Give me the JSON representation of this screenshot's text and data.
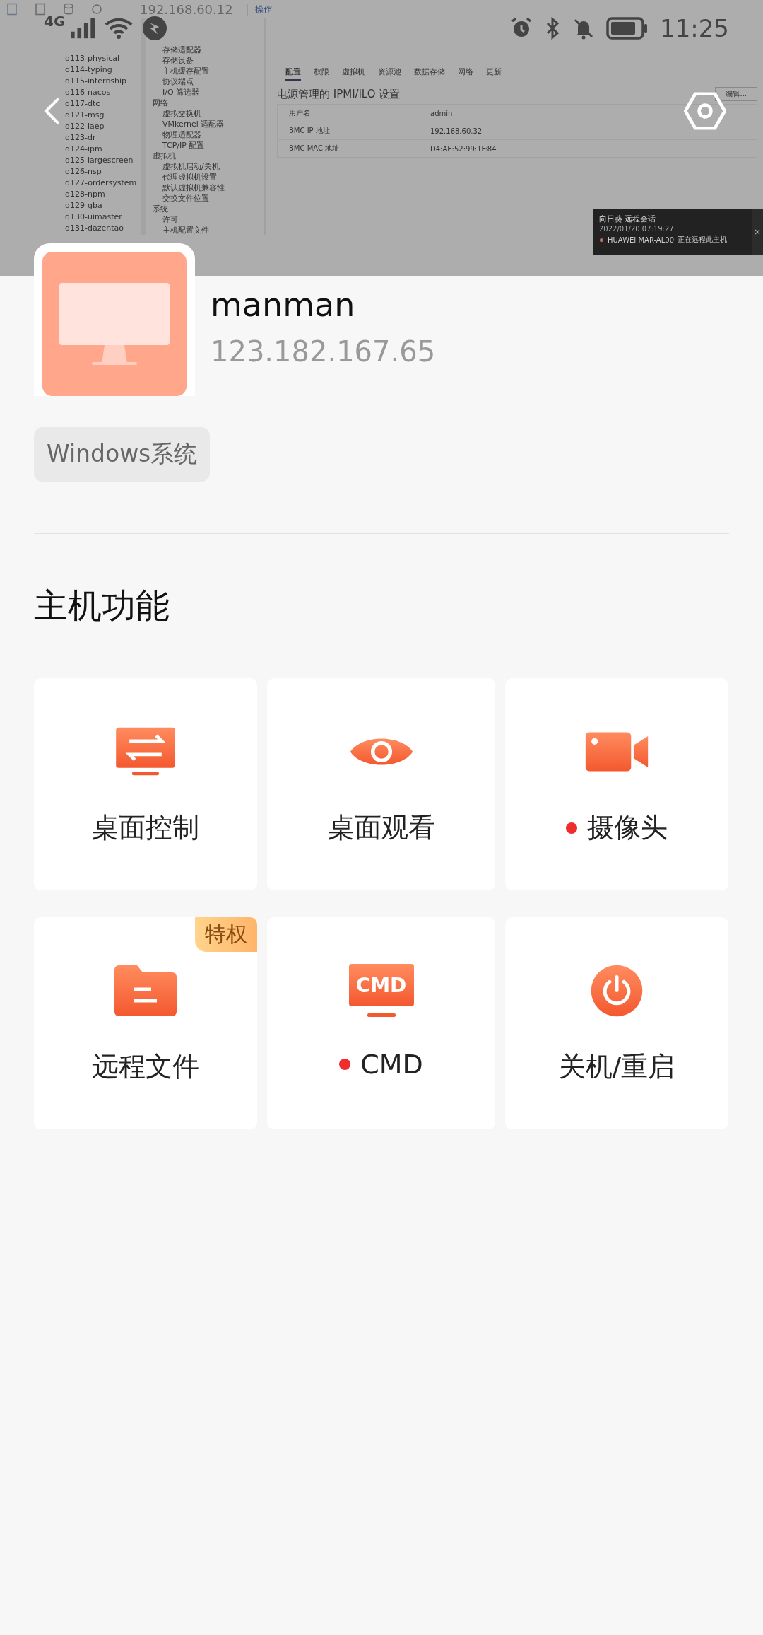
{
  "remote_screen": {
    "address": "192.168.60.12",
    "actions_menu": "操作",
    "vm_list": [
      "d113-physical",
      "d114-typing",
      "d115-internship",
      "d116-nacos",
      "d117-dtc",
      "d121-msg",
      "d122-iaep",
      "d123-dr",
      "d124-ipm",
      "d125-largescreen",
      "d126-nsp",
      "d127-ordersystem",
      "d128-npm",
      "d129-gba",
      "d130-uimaster",
      "d131-dazentao"
    ],
    "tabs": [
      {
        "label": "配置",
        "selected": true
      },
      {
        "label": "权限",
        "selected": false
      },
      {
        "label": "虚拟机",
        "selected": false
      },
      {
        "label": "资源池",
        "selected": false
      },
      {
        "label": "数据存储",
        "selected": false
      },
      {
        "label": "网络",
        "selected": false
      },
      {
        "label": "更新",
        "selected": false
      }
    ],
    "tree": [
      {
        "label": "存储适配器"
      },
      {
        "label": "存储设备"
      },
      {
        "label": "主机缓存配置"
      },
      {
        "label": "协议端点"
      },
      {
        "label": "I/O 筛选器"
      },
      {
        "label": "网络",
        "children": [
          {
            "label": "虚拟交换机"
          },
          {
            "label": "VMkernel 适配器"
          },
          {
            "label": "物理适配器"
          },
          {
            "label": "TCP/IP 配置"
          }
        ]
      },
      {
        "label": "虚拟机",
        "children": [
          {
            "label": "虚拟机启动/关机"
          },
          {
            "label": "代理虚拟机设置"
          },
          {
            "label": "默认虚拟机兼容性"
          },
          {
            "label": "交换文件位置"
          }
        ]
      },
      {
        "label": "系统",
        "children": [
          {
            "label": "许可"
          },
          {
            "label": "主机配置文件"
          }
        ]
      }
    ],
    "heading": "电源管理的 IPMI/iLO 设置",
    "edit_button": "编辑...",
    "rows": [
      {
        "label": "用户名",
        "value": "admin"
      },
      {
        "label": "BMC IP 地址",
        "value": "192.168.60.32"
      },
      {
        "label": "BMC MAC 地址",
        "value": "D4:AE:52:99:1F:84"
      }
    ],
    "notification": {
      "title": "向日葵 远程会话",
      "time": "2022/01/20 07:19:27",
      "device": "HUAWEI MAR-AL00",
      "status": "正在远程此主机",
      "close": "×"
    }
  },
  "status_bar": {
    "network": "4G",
    "time": "11:25"
  },
  "host": {
    "name": "manman",
    "ip": "123.182.167.65",
    "tag": "Windows系统"
  },
  "section_title": "主机功能",
  "functions": [
    {
      "kind": "desktop-control",
      "label": "桌面控制",
      "dot": false
    },
    {
      "kind": "desktop-view",
      "label": "桌面观看",
      "dot": false
    },
    {
      "kind": "camera",
      "label": "摄像头",
      "dot": true
    },
    {
      "kind": "files",
      "label": "远程文件",
      "dot": false,
      "badge": "特权"
    },
    {
      "kind": "cmd",
      "label": "CMD",
      "dot": true,
      "icon_text": "CMD"
    },
    {
      "kind": "power",
      "label": "关机/重启",
      "dot": false
    }
  ]
}
